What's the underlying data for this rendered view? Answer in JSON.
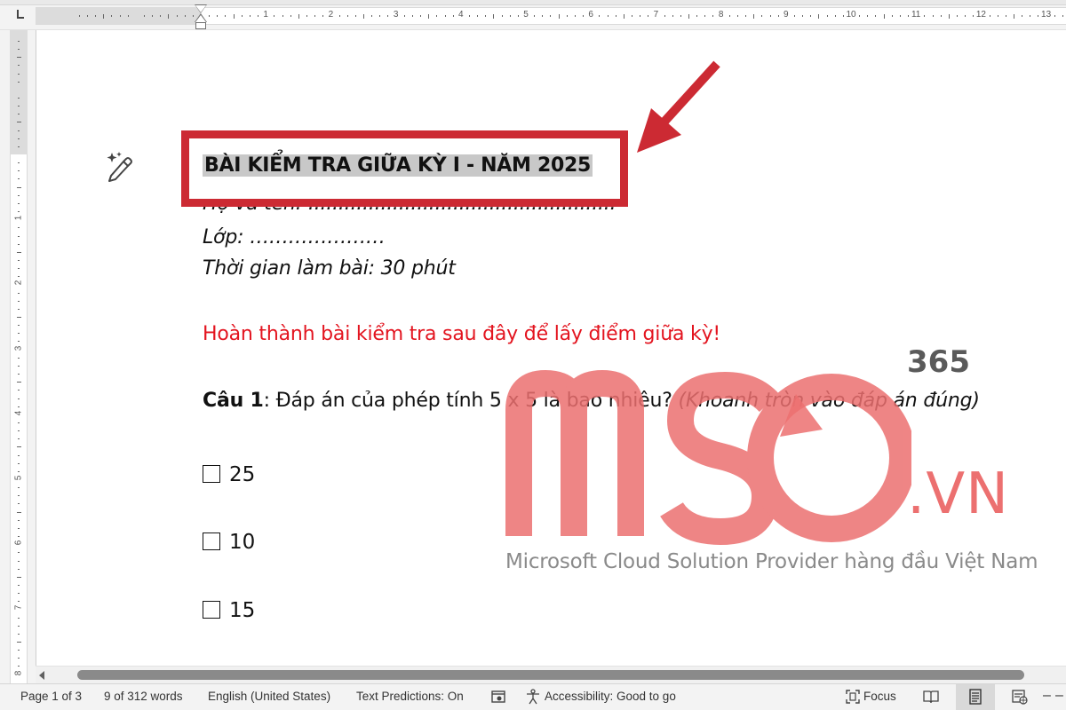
{
  "ruler": {
    "numbers": [
      "1",
      "2",
      "3",
      "4",
      "5",
      "6",
      "7",
      "8",
      "9",
      "10",
      "11",
      "12",
      "13"
    ],
    "vertical_numbers": [
      "1",
      "2",
      "3",
      "4",
      "5",
      "6",
      "7",
      "8"
    ]
  },
  "document": {
    "title": "BÀI KIỂM TRA GIỮA KỲ I - NĂM 2025",
    "name_line": "Họ và tên: ...................................................",
    "class_line": "Lớp: …………………",
    "time_line": "Thời gian làm bài: 30 phút",
    "instruction": "Hoàn thành bài kiểm tra sau đây để lấy điểm giữa kỳ!",
    "question": {
      "label": "Câu 1",
      "text": ": Đáp án của phép tính 5 x 5 là bao nhiêu? ",
      "hint": "(Khoanh tròn vào đáp án đúng)"
    },
    "options": [
      "25",
      "10",
      "15"
    ]
  },
  "annotation": {
    "box_color": "#cc2a33",
    "arrow_color": "#cc2a33"
  },
  "watermark": {
    "brand": "MSO",
    "suffix": "365",
    "domain": ".VN",
    "tagline": "Microsoft Cloud Solution Provider hàng đầu Việt Nam",
    "color": "#ec7070"
  },
  "statusbar": {
    "page": "Page 1 of 3",
    "words": "9 of 312 words",
    "language": "English (United States)",
    "text_predictions": "Text Predictions: On",
    "accessibility": "Accessibility: Good to go",
    "focus": "Focus"
  }
}
